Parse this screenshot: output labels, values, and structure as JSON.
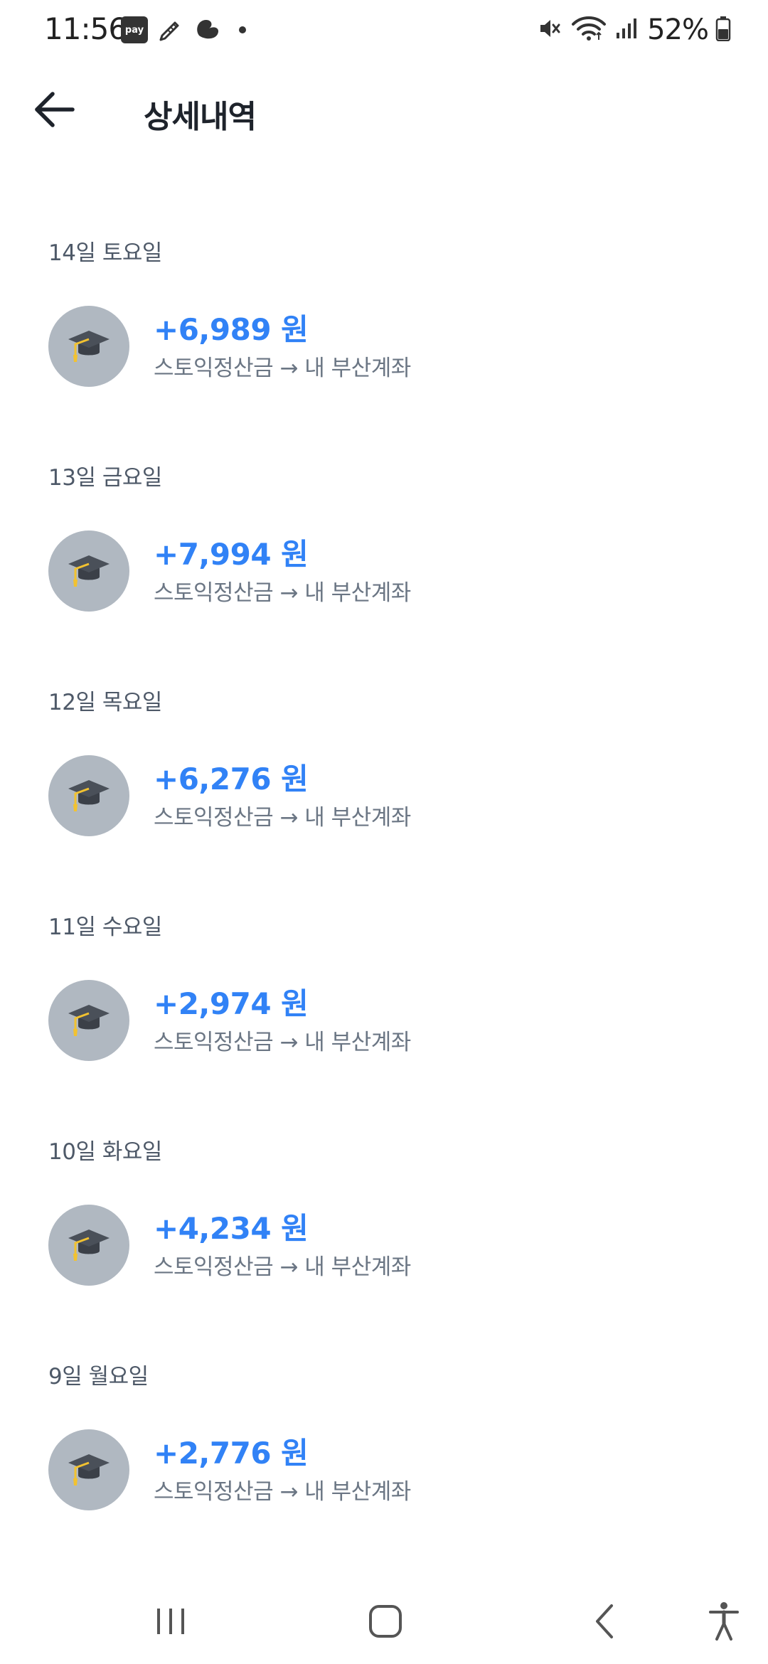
{
  "status_bar": {
    "time": "11:56",
    "pay_badge": "pay",
    "battery": "52%"
  },
  "header": {
    "title": "상세내역"
  },
  "colors": {
    "amount": "#3182f6",
    "avatar_bg": "#b0b8c1",
    "day_label": "#4e5968",
    "description": "#6b7684"
  },
  "transactions": [
    {
      "day": "14일 토요일",
      "amount": "+6,989 원",
      "description": "스토익정산금 → 내 부산계좌",
      "icon": "graduation-cap-icon"
    },
    {
      "day": "13일 금요일",
      "amount": "+7,994 원",
      "description": "스토익정산금 → 내 부산계좌",
      "icon": "graduation-cap-icon"
    },
    {
      "day": "12일 목요일",
      "amount": "+6,276 원",
      "description": "스토익정산금 → 내 부산계좌",
      "icon": "graduation-cap-icon"
    },
    {
      "day": "11일 수요일",
      "amount": "+2,974 원",
      "description": "스토익정산금 → 내 부산계좌",
      "icon": "graduation-cap-icon"
    },
    {
      "day": "10일 화요일",
      "amount": "+4,234 원",
      "description": "스토익정산금 → 내 부산계좌",
      "icon": "graduation-cap-icon"
    },
    {
      "day": "9일 월요일",
      "amount": "+2,776 원",
      "description": "스토익정산금 → 내 부산계좌",
      "icon": "graduation-cap-icon"
    }
  ],
  "nav_bar": {
    "recents": "recents-icon",
    "home": "home-icon",
    "back": "back-icon",
    "accessibility": "accessibility-icon"
  }
}
